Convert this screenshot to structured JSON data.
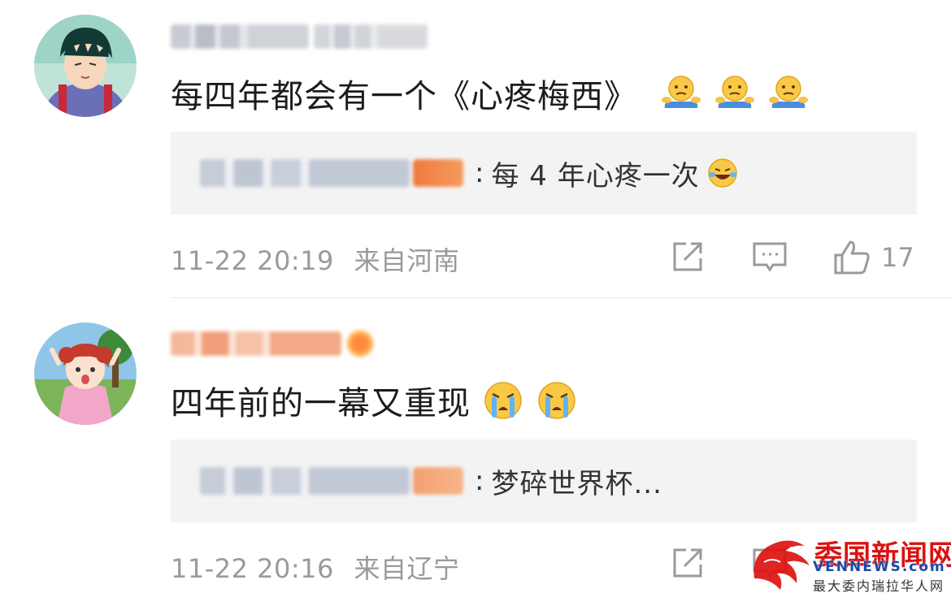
{
  "comments": [
    {
      "text": "每四年都会有一个《心疼梅西》",
      "text_emojis": [
        "shrug-emoji",
        "shrug-emoji",
        "shrug-emoji"
      ],
      "reply": {
        "separator": ":",
        "text": "每 4 年心疼一次",
        "emoji": "laugh-cry-emoji"
      },
      "time": "11-22 20:19",
      "location": "来自河南",
      "like_count": "17"
    },
    {
      "text": "四年前的一幕又重现",
      "text_emojis": [
        "crying-emoji",
        "crying-emoji"
      ],
      "reply": {
        "separator": ":",
        "text": "梦碎世界杯..."
      },
      "time": "11-22 20:16",
      "location": "来自辽宁",
      "like_count": ""
    }
  ],
  "watermark": {
    "title": "委国新闻网",
    "url": "VENNEWS.com",
    "subtitle": "最大委内瑞拉华人网"
  },
  "colors": {
    "text": "#1c1c1c",
    "meta": "#9a9a9a",
    "reply_bg": "#f3f3f3",
    "badge_orange": "#f07a40",
    "watermark_red": "#d11111",
    "watermark_blue": "#1a4aa8"
  }
}
